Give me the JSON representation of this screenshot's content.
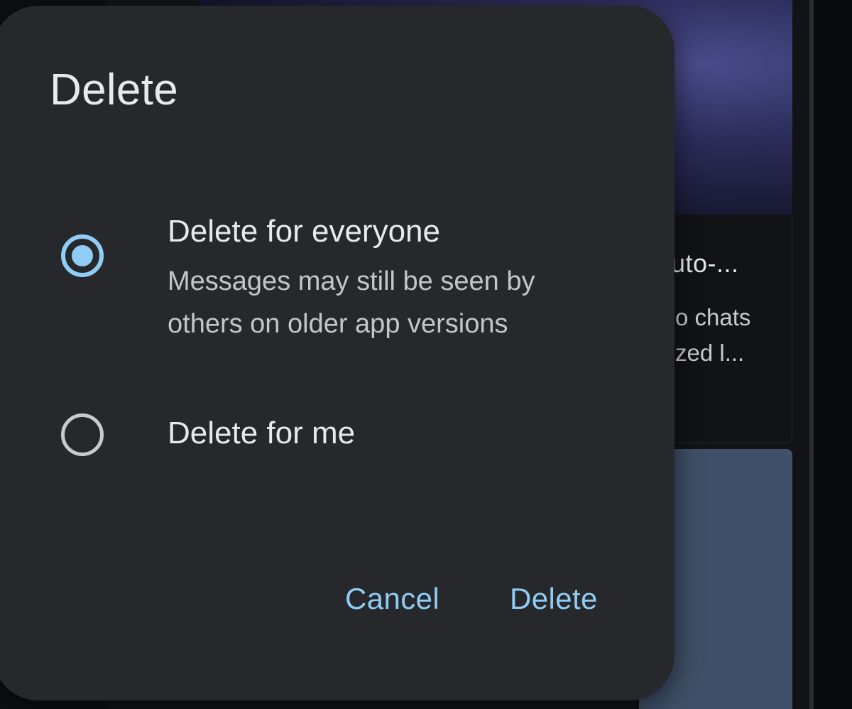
{
  "background": {
    "card": {
      "title": "uto-...",
      "lines": [
        "o chats",
        "zed l..."
      ]
    }
  },
  "dialog": {
    "title": "Delete",
    "options": [
      {
        "label": "Delete for everyone",
        "description": "Messages may still be seen by others on older app versions",
        "selected": true
      },
      {
        "label": "Delete for me",
        "selected": false
      }
    ],
    "buttons": {
      "cancel": "Cancel",
      "delete": "Delete"
    }
  },
  "colors": {
    "accent": "#8fcdf4",
    "dialog_surface": "#26282c",
    "text_primary": "#e8e9ec",
    "text_secondary": "#c3c5ca"
  },
  "icons": {
    "selected_radio": "radio-checked-icon",
    "unselected_radio": "radio-unchecked-icon"
  }
}
